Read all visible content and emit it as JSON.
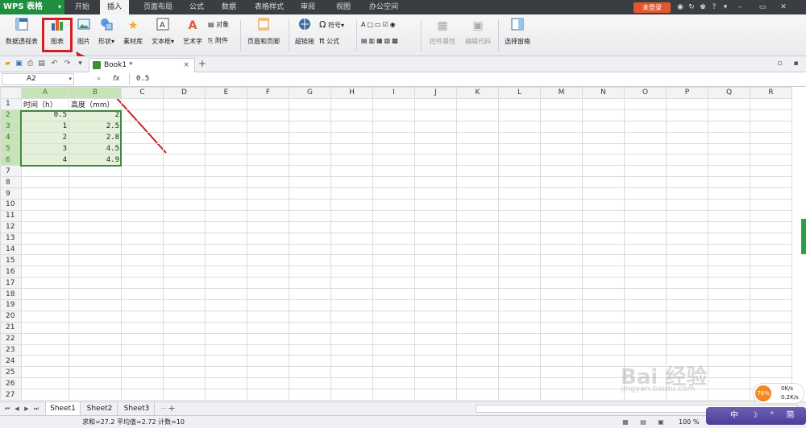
{
  "titlebar": {
    "app_name": "WPS 表格",
    "app_caret": "▾",
    "menus": [
      "开始",
      "插入",
      "页面布局",
      "公式",
      "数据",
      "表格样式",
      "审阅",
      "视图",
      "办公空间"
    ],
    "active_menu_index": 1,
    "login_label": "未登录",
    "window_controls": {
      "min": "–",
      "max": "▭",
      "close": "✕"
    }
  },
  "ribbon": {
    "pivot_label": "数据透视表",
    "chart_label": "图表",
    "picture_label": "图片",
    "shape_label": "形状",
    "material_label": "素材库",
    "textbox_label": "文本框",
    "wordart_label": "艺术字",
    "object_label": "对象",
    "attachment_label": "附件",
    "header_footer_label": "页眉和页脚",
    "hyperlink_label": "超链接",
    "symbol_label": "符号",
    "formula_label": "公式",
    "control_props_label": "控件属性",
    "edit_code_label": "编辑代码",
    "select_pane_label": "选择窗格",
    "dropdown_caret": "▾",
    "omega": "Ω",
    "pi": "π"
  },
  "tabs": {
    "doc_tab_label": "Book1 *",
    "close_glyph": "×",
    "add_glyph": "+"
  },
  "formula_bar": {
    "cell_ref": "A2",
    "fx_label": "fx",
    "formula_value": "0.5"
  },
  "grid": {
    "columns": [
      "A",
      "B",
      "C",
      "D",
      "E",
      "F",
      "G",
      "H",
      "I",
      "J",
      "K",
      "L",
      "M",
      "N",
      "O",
      "P",
      "Q",
      "R"
    ],
    "row_count": 27,
    "header_row": {
      "A": "时间（h）",
      "B": "高度（mm）"
    },
    "data_rows": [
      {
        "A": "0.5",
        "B": "2"
      },
      {
        "A": "1",
        "B": "2.5"
      },
      {
        "A": "2",
        "B": "2.8"
      },
      {
        "A": "3",
        "B": "4.5"
      },
      {
        "A": "4",
        "B": "4.9"
      }
    ]
  },
  "sheets": {
    "names": [
      "Sheet1",
      "Sheet2",
      "Sheet3"
    ],
    "active_index": 0,
    "more_glyph": "···",
    "add_glyph": "+"
  },
  "statusbar": {
    "summary": "求和=27.2  平均值=2.72  计数=10",
    "zoom": "100 %"
  },
  "overlay": {
    "net_percent": "78%",
    "net_up": "0K/s",
    "net_down": "0.2K/s",
    "ime_text": "中 ☽ ° 简",
    "watermark": "Bai 经验",
    "watermark_sub": "jingyan.baidu.com"
  },
  "colors": {
    "accent_green": "#1e8f3e",
    "highlight_red": "#d62020",
    "selection_fill": "#e3f1d9",
    "login_orange": "#e4572e"
  },
  "icons": [
    "pivot-table-icon",
    "bar-chart-icon",
    "picture-icon",
    "shape-icon",
    "star-icon",
    "textbox-icon",
    "wordart-icon",
    "object-icon",
    "attachment-icon",
    "header-footer-icon",
    "hyperlink-icon",
    "omega-icon",
    "pi-icon",
    "control-icon",
    "code-icon",
    "select-pane-icon"
  ]
}
